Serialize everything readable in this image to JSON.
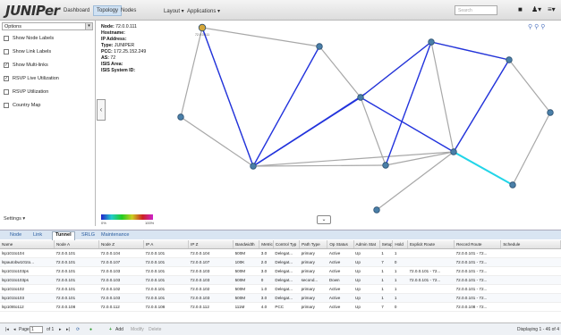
{
  "topbar": {
    "logo": "JUNIPer",
    "nav": [
      "Dashboard",
      "Topology",
      "Nodes",
      "Layout ▾",
      "Applications ▾"
    ],
    "search_placeholder": "Search"
  },
  "options": {
    "select_label": "Options",
    "items": [
      {
        "label": "Show Node Labels",
        "checked": false
      },
      {
        "label": "Show Link Labels",
        "checked": false
      },
      {
        "label": "Show Multi-links",
        "checked": true
      },
      {
        "label": "RSVP Live Utilization",
        "checked": true
      },
      {
        "label": "RSVP Utilization",
        "checked": false
      },
      {
        "label": "Country Map",
        "checked": false
      }
    ],
    "settings_label": "Settings ▾"
  },
  "node_info": {
    "lines": [
      {
        "k": "Node:",
        "v": "72.0.0.111"
      },
      {
        "k": "Hostname:",
        "v": ""
      },
      {
        "k": "IP Address:",
        "v": ""
      },
      {
        "k": "Type:",
        "v": "JUNIPER"
      },
      {
        "k": "PCC:",
        "v": "172.25.152.249"
      },
      {
        "k": "AS:",
        "v": "72"
      },
      {
        "k": "ISIS Area:",
        "v": ""
      },
      {
        "k": "ISIS System ID:",
        "v": ""
      }
    ],
    "selected_label": "72.0.0.111"
  },
  "legend": {
    "min": "0%",
    "max": "100%"
  },
  "tabs": [
    "Node",
    "Link",
    "Tunnel",
    "SRLG",
    "Maintenance"
  ],
  "table": {
    "headers": [
      "Name",
      "Node A",
      "Node Z",
      "IP A",
      "IP Z",
      "Bandwidth",
      "Metric",
      "Control Typ",
      "Path Type",
      "Op Status",
      "Admin Stat",
      "Setup",
      "Hold",
      "Explicit Route",
      "Record Route",
      "Schedule"
    ],
    "rows": [
      [
        "lsp101to104",
        "72.0.0.101",
        "72.0.0.104",
        "72.0.0.101",
        "72.0.0.104",
        "500M",
        "3.0",
        "Delegat...",
        "primary",
        "Active",
        "Up",
        "1",
        "1",
        "",
        "72.0.0.101 - 72...",
        ""
      ],
      [
        "lspautobw101to...",
        "72.0.0.101",
        "72.0.0.107",
        "72.0.0.101",
        "72.0.0.107",
        "100K",
        "2.0",
        "Delegat...",
        "primary",
        "Active",
        "Up",
        "7",
        "0",
        "",
        "72.0.0.101 - 72...",
        ""
      ],
      [
        "lsp101to103ps",
        "72.0.0.101",
        "72.0.0.103",
        "72.0.0.101",
        "72.0.0.103",
        "500M",
        "3.0",
        "Delegat...",
        "primary",
        "Active",
        "Up",
        "1",
        "1",
        "72.0.0.101 - 72...",
        "72.0.0.101 - 72...",
        ""
      ],
      [
        "lsp101to103ps",
        "72.0.0.101",
        "72.0.0.103",
        "72.0.0.101",
        "72.0.0.103",
        "500M",
        "0",
        "Delegat...",
        "second...",
        "Down",
        "Up",
        "1",
        "1",
        "72.0.0.101 - 72...",
        "72.0.0.101 - 72...",
        ""
      ],
      [
        "lsp101to102",
        "72.0.0.101",
        "72.0.0.102",
        "72.0.0.101",
        "72.0.0.102",
        "500M",
        "1.0",
        "Delegat...",
        "primary",
        "Active",
        "Up",
        "1",
        "1",
        "",
        "72.0.0.101 - 72...",
        ""
      ],
      [
        "lsp101to103",
        "72.0.0.101",
        "72.0.0.103",
        "72.0.0.101",
        "72.0.0.103",
        "500M",
        "3.0",
        "Delegat...",
        "primary",
        "Active",
        "Up",
        "1",
        "1",
        "",
        "72.0.0.101 - 72...",
        ""
      ],
      [
        "lsp108to112",
        "72.0.0.108",
        "72.0.0.112",
        "72.0.0.108",
        "72.0.0.112",
        "111M",
        "4.0",
        "PCC",
        "primary",
        "Active",
        "Up",
        "7",
        "0",
        "",
        "72.0.0.108 - 72...",
        ""
      ]
    ]
  },
  "pager": {
    "page_label": "Page",
    "page_value": "1",
    "of_label": "of 1",
    "add_label": "Add",
    "modify_label": "Modify",
    "delete_label": "Delete",
    "displaying": "Displaying 1 - 46 of 4"
  },
  "colors": {
    "accent": "#2a5da0",
    "link_gray": "#a8a8a8",
    "link_blue": "#2233dd",
    "link_cyan": "#22d5e8",
    "node": "#4a7fa8"
  }
}
